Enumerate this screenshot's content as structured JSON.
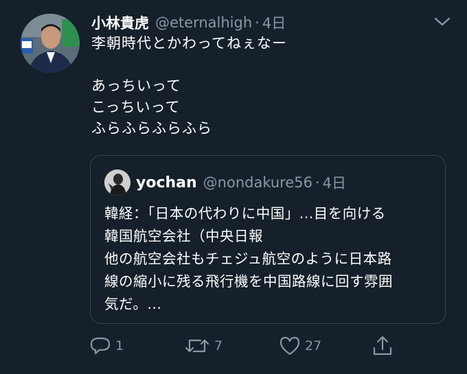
{
  "tweet": {
    "author_name": "小林貴虎",
    "author_handle": "@eternalhigh",
    "separator": "·",
    "time": "4日",
    "lines": [
      "李朝時代とかわってねぇなー",
      "",
      "あっちいって",
      "こっちいって",
      "ふらふらふらふら"
    ]
  },
  "quote": {
    "author_name": "yochan",
    "author_handle": "@nondakure56",
    "separator": "·",
    "time": "4日",
    "lines": [
      "韓経：「日本の代わりに中国」...目を向ける",
      "韓国航空会社（中央日報",
      "他の航空会社もチェジュ航空のように日本路",
      "線の縮小に残る飛行機を中国路線に回す雰囲",
      "気だ。..."
    ]
  },
  "actions": {
    "reply_count": "1",
    "retweet_count": "7",
    "like_count": "27"
  },
  "icons": {
    "menu": "chevron-down-icon",
    "reply": "reply-icon",
    "retweet": "retweet-icon",
    "like": "heart-icon",
    "share": "share-icon"
  },
  "colors": {
    "background": "#15202b",
    "secondary_text": "#8899a6",
    "border": "#38444d"
  }
}
